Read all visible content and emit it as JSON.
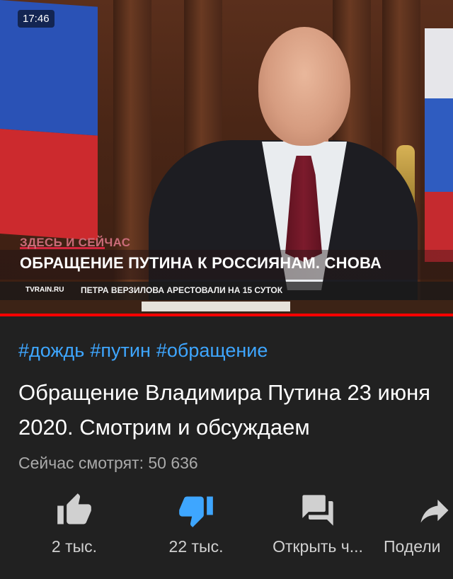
{
  "video": {
    "time_badge": "17:46",
    "banner_tag": "ЗДЕСЬ И СЕЙЧАС",
    "banner_title": "ОБРАЩЕНИЕ ПУТИНА К РОССИЯНАМ. СНОВА",
    "ticker_brand": "TVRAIN.RU",
    "ticker_text": "ПЕТРА ВЕРЗИЛОВА АРЕСТОВАЛИ НА 15 СУТОК",
    "progress_fraction": 1.0,
    "progress_color": "#ff0000"
  },
  "info": {
    "hashtags": [
      "#дождь",
      "#путин",
      "#обращение"
    ],
    "title": "Обращение Владимира Путина 23 июня 2020. Смотрим и обсуждаем",
    "viewers": "Сейчас смотрят: 50 636",
    "hashtag_color": "#3ea6ff"
  },
  "actions": [
    {
      "name": "like",
      "icon": "thumbs-up-icon",
      "label": "2 тыс.",
      "active": false
    },
    {
      "name": "dislike",
      "icon": "thumbs-down-icon",
      "label": "22 тыс.",
      "active": true,
      "active_color": "#3ea6ff"
    },
    {
      "name": "chat",
      "icon": "chat-icon",
      "label": "Открыть ч...",
      "active": false
    },
    {
      "name": "share",
      "icon": "share-icon",
      "label": "Подели",
      "active": false
    }
  ]
}
